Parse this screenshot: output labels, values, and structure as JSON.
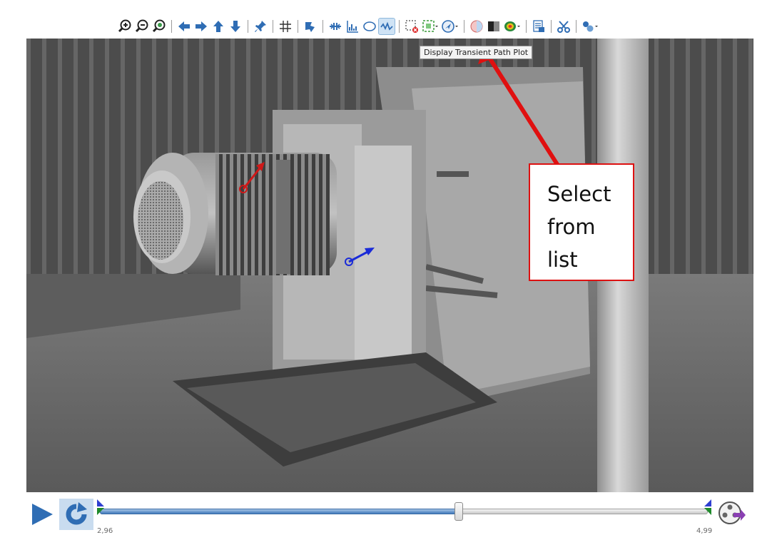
{
  "toolbar": {
    "icons": [
      "zoom-in-icon",
      "zoom-out-icon",
      "zoom-fit-icon",
      "arrow-left-icon",
      "arrow-right-icon",
      "arrow-up-icon",
      "arrow-down-icon",
      "pin-icon",
      "grid-icon",
      "rotate-shape-icon",
      "points-icon",
      "bar-chart-icon",
      "ellipse-icon",
      "waveform-icon",
      "clear-selection-icon",
      "select-region-icon",
      "transient-path-icon",
      "color-circle-icon",
      "grayscale-icon",
      "heatmap-icon",
      "report-icon",
      "scissors-icon",
      "settings-icon"
    ],
    "tooltip": "Display Transient Path Plot"
  },
  "annotation": {
    "callout_lines": [
      "Select",
      "from",
      "list"
    ],
    "accent": "#e01010"
  },
  "timeline": {
    "start_label": "2,96",
    "end_label": "4,99",
    "position_fraction": 0.59,
    "fill_color": "#3f78ba"
  },
  "colors": {
    "icon_blue": "#2f6db4",
    "vector_red": "#d01818",
    "vector_blue": "#1a2bd8"
  }
}
